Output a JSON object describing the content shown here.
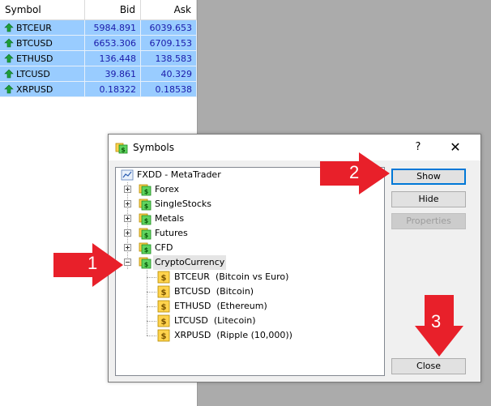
{
  "market_watch": {
    "columns": [
      "Symbol",
      "Bid",
      "Ask"
    ],
    "rows": [
      {
        "symbol": "BTCEUR",
        "bid": "5984.891",
        "ask": "6039.653"
      },
      {
        "symbol": "BTCUSD",
        "bid": "6653.306",
        "ask": "6709.153"
      },
      {
        "symbol": "ETHUSD",
        "bid": "136.448",
        "ask": "138.583"
      },
      {
        "symbol": "LTCUSD",
        "bid": "39.861",
        "ask": "40.329"
      },
      {
        "symbol": "XRPUSD",
        "bid": "0.18322",
        "ask": "0.18538"
      }
    ]
  },
  "dialog": {
    "title": "Symbols",
    "help": "?",
    "close": "✕",
    "tree": {
      "root": "FXDD - MetaTrader",
      "groups": [
        "Forex",
        "SingleStocks",
        "Metals",
        "Futures",
        "CFD",
        "CryptoCurrency"
      ],
      "crypto_items": [
        "BTCEUR  (Bitcoin vs Euro)",
        "BTCUSD  (Bitcoin)",
        "ETHUSD  (Ethereum)",
        "LTCUSD  (Litecoin)",
        "XRPUSD  (Ripple (10,000))"
      ]
    },
    "buttons": {
      "show": "Show",
      "hide": "Hide",
      "properties": "Properties",
      "close": "Close"
    }
  },
  "annotations": {
    "one": "1",
    "two": "2",
    "three": "3"
  },
  "colors": {
    "row_highlight": "#99ccff",
    "callout_red": "#e8202a",
    "up_arrow_green": "#1e9e3a"
  },
  "icons": [
    "up-arrow-icon",
    "symbols-folder-icon",
    "dollar-icon",
    "metatrader-icon"
  ]
}
